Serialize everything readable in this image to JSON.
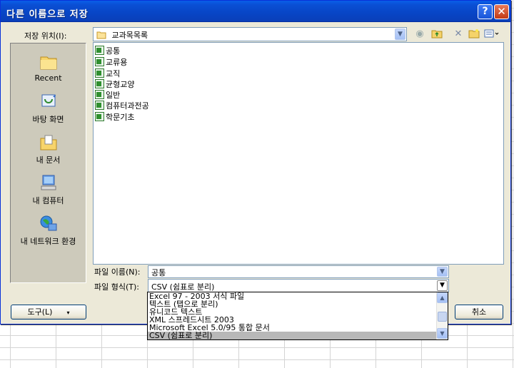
{
  "dialog": {
    "title": "다른 이름으로 저장",
    "help_symbol": "?",
    "close_symbol": "✕"
  },
  "save_in": {
    "label": "저장 위치(I):",
    "value": "교과목목록"
  },
  "places": [
    {
      "label": "Recent",
      "icon": "recent-folder-icon"
    },
    {
      "label": "바탕 화면",
      "icon": "desktop-icon"
    },
    {
      "label": "내 문서",
      "icon": "my-documents-icon"
    },
    {
      "label": "내 컴퓨터",
      "icon": "my-computer-icon"
    },
    {
      "label": "내 네트워크 환경",
      "icon": "network-icon"
    }
  ],
  "files": [
    "공통",
    "교류용",
    "교직",
    "균형교양",
    "일반",
    "컴퓨터과전공",
    "학문기초"
  ],
  "filename": {
    "label": "파일 이름(N):",
    "value": "공통"
  },
  "filetype": {
    "label": "파일 형식(T):",
    "value": "CSV (쉼표로 분리)",
    "options": [
      "Excel 97 - 2003 서식 파일",
      "텍스트 (탭으로 분리)",
      "유니코드 텍스트",
      "XML 스프레드시트 2003",
      "Microsoft Excel 5.0/95 통합 문서",
      "CSV (쉼표로 분리)"
    ],
    "selected_index": 5
  },
  "buttons": {
    "tools": "도구(L)",
    "cancel": "취소"
  },
  "colors": {
    "titlebar": "#0a4fd4",
    "dialog_bg": "#ece9d8",
    "places_bg": "#cdcabb"
  }
}
